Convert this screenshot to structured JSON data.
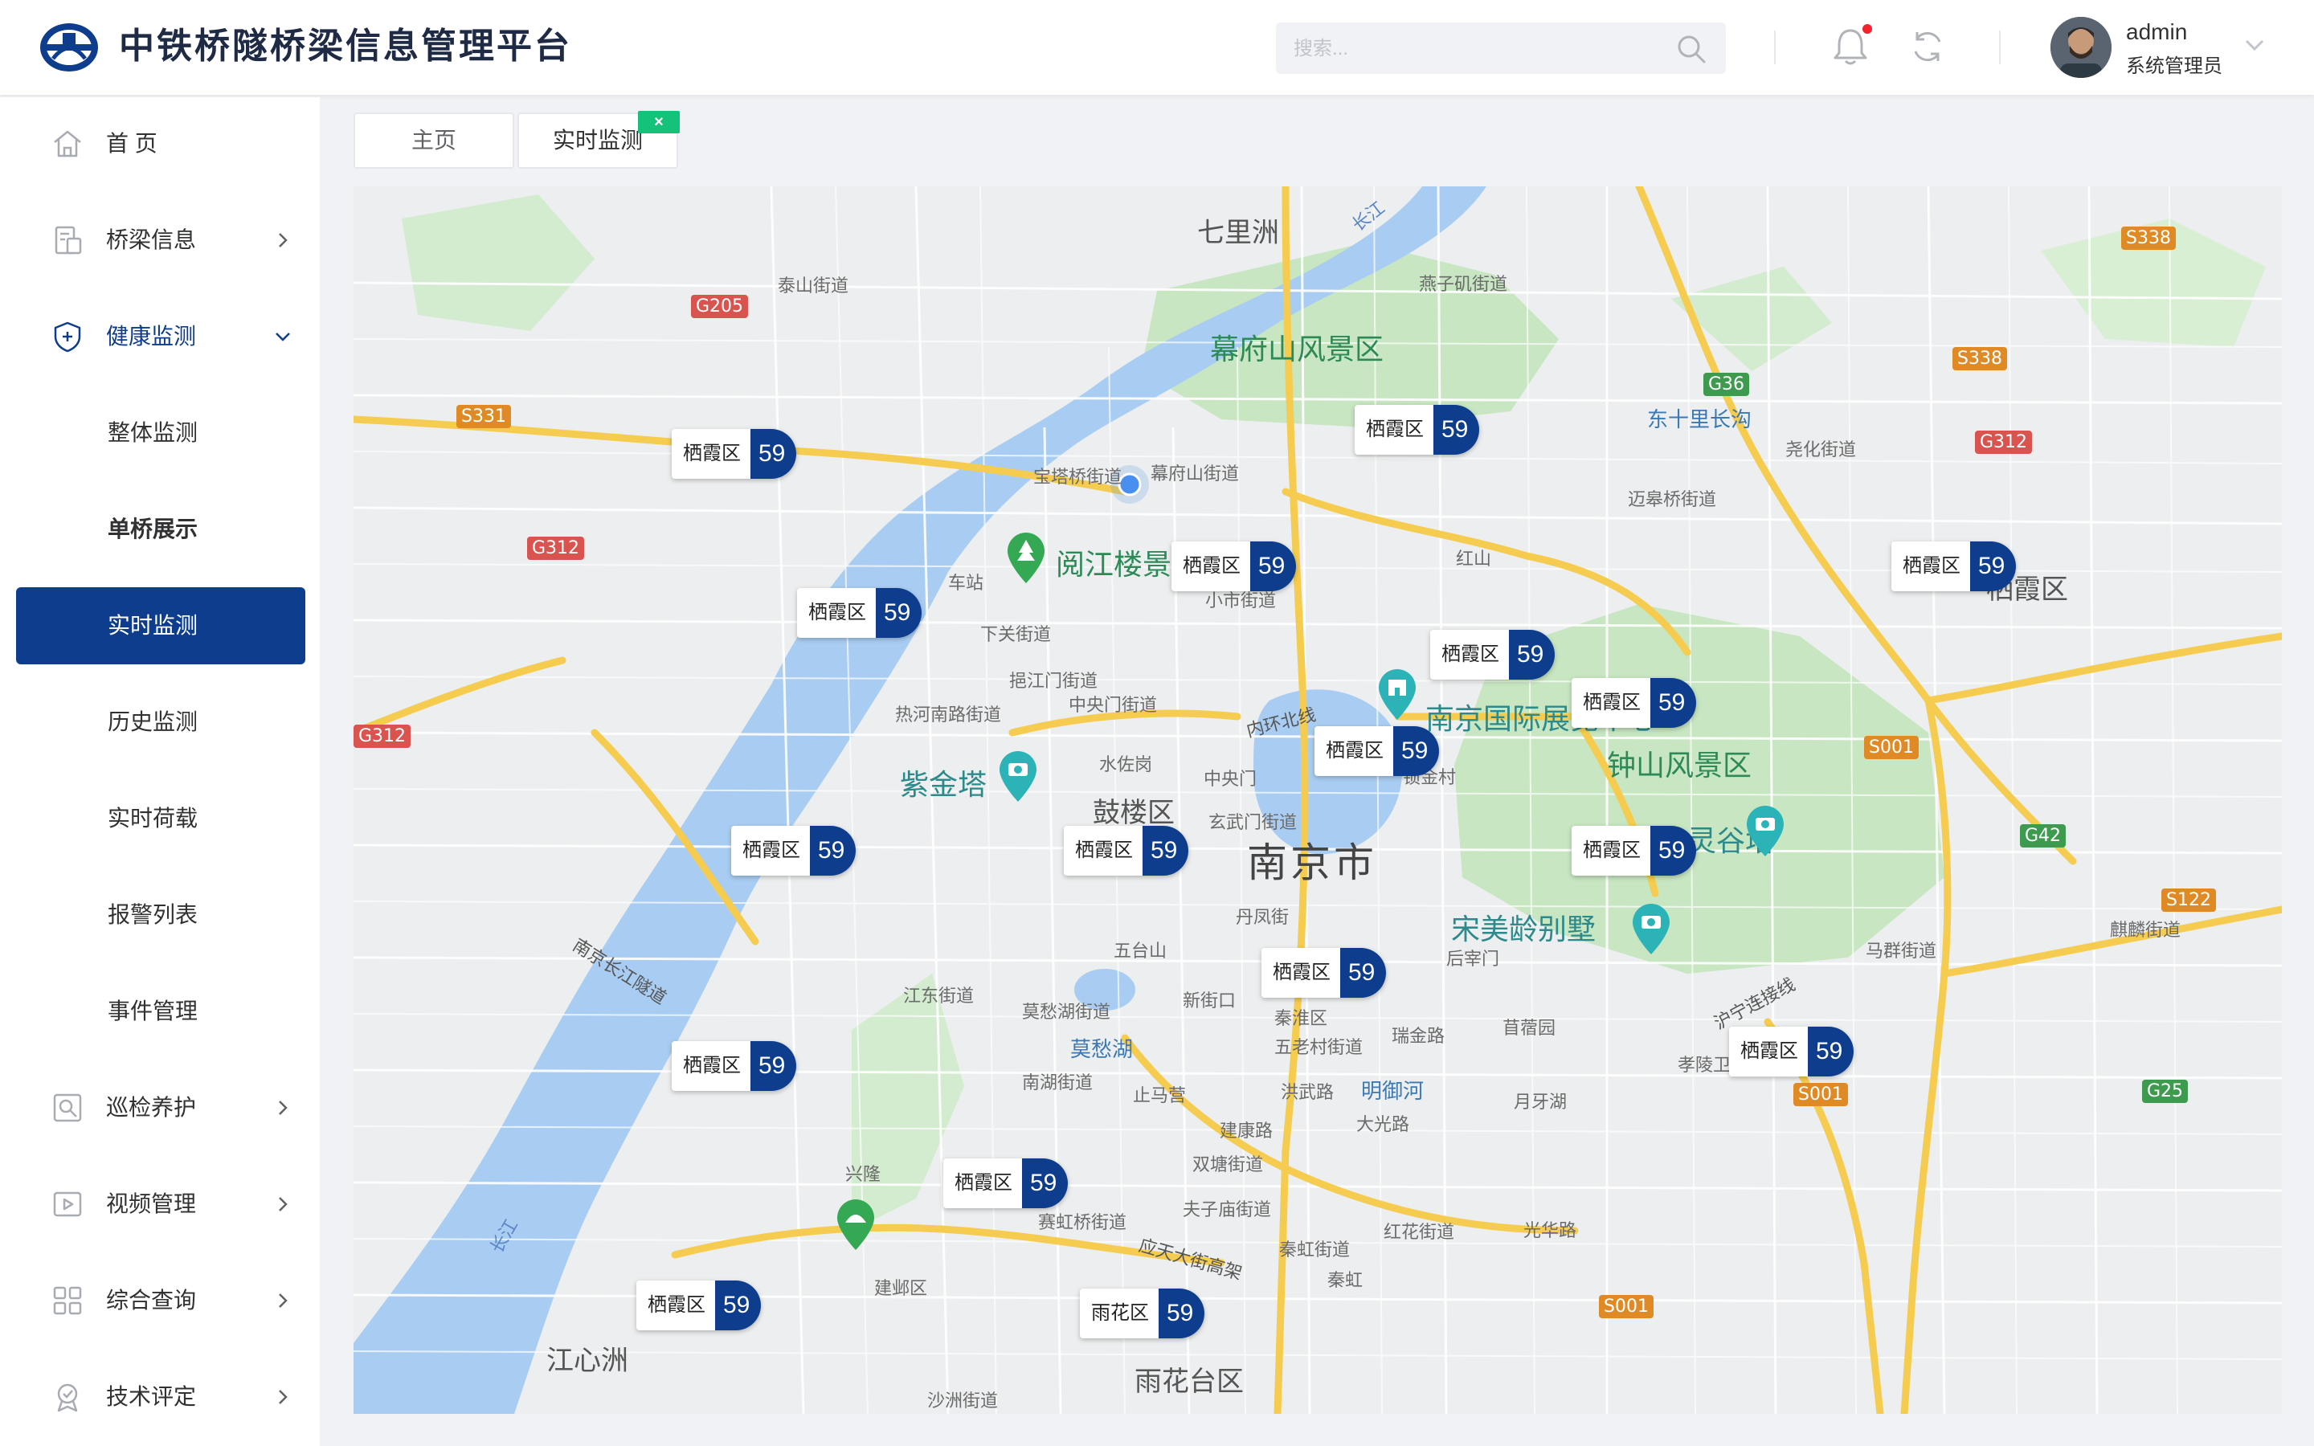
{
  "header": {
    "title": "中铁桥隧桥梁信息管理平台",
    "search_placeholder": "搜索...",
    "user": {
      "name": "admin",
      "role": "系统管理员"
    },
    "notification_dot": true
  },
  "sidebar": {
    "items": [
      {
        "label": "首 页",
        "icon": "home-icon"
      },
      {
        "label": "桥梁信息",
        "icon": "building-icon",
        "has_arrow": true
      },
      {
        "label": "健康监测",
        "icon": "shield-icon",
        "expanded": true,
        "children": [
          {
            "label": "整体监测"
          },
          {
            "label": "单桥展示"
          },
          {
            "label": "实时监测",
            "active": true
          },
          {
            "label": "历史监测"
          },
          {
            "label": "实时荷载"
          },
          {
            "label": "报警列表"
          },
          {
            "label": "事件管理"
          }
        ]
      },
      {
        "label": "巡检养护",
        "icon": "inspection-icon",
        "has_arrow": true
      },
      {
        "label": "视频管理",
        "icon": "video-icon",
        "has_arrow": true
      },
      {
        "label": "综合查询",
        "icon": "grid-icon",
        "has_arrow": true
      },
      {
        "label": "技术评定",
        "icon": "badge-icon",
        "has_arrow": true
      }
    ]
  },
  "tabs": [
    {
      "label": "主页"
    },
    {
      "label": "实时监测",
      "active": true,
      "close": "×"
    }
  ],
  "map": {
    "city_label": "南京市",
    "district_labels": [
      "鼓楼区",
      "栖霞区",
      "雨花台区",
      "秦淮区",
      "建邺区"
    ],
    "scenic_labels": [
      "幕府山风景区",
      "钟山风景区",
      "阅江楼景",
      "紫金塔",
      "宋美龄别墅",
      "灵谷塔",
      "南京国际展览中心"
    ],
    "places": [
      "七里洲",
      "江心洲",
      "泰山街道",
      "燕子矶街道",
      "宝塔桥街道",
      "幕府山街道",
      "迈皋桥街道",
      "尧化街道",
      "东十里长沟",
      "车站",
      "下关街道",
      "挹江门街道",
      "中央门街道",
      "小市街道",
      "红山",
      "热河南路街道",
      "水佐岗",
      "中央门",
      "玄武门街道",
      "锁金村",
      "五台山",
      "丹凤街",
      "江东街道",
      "莫愁湖街道",
      "莫愁湖",
      "南湖街道",
      "止马营",
      "新街口",
      "秦淮区",
      "五老村街道",
      "瑞金路",
      "后宰门",
      "苜蓿园",
      "孝陵卫",
      "月牙湖",
      "洪武路",
      "明御河",
      "大光路",
      "建康路",
      "双塘街道",
      "夫子庙街道",
      "兴隆",
      "赛虹桥街道",
      "秦虹街道",
      "秦虹",
      "红花街道",
      "光华路",
      "建邺区",
      "沙洲街道",
      "马群街道",
      "麒麟街道",
      "南京长江隧道",
      "内环北线",
      "应天大街高架",
      "沪宁连接线",
      "长江"
    ],
    "road_shields": [
      "G205",
      "S331",
      "G312",
      "G36",
      "S338",
      "S001",
      "G42",
      "S122",
      "G25"
    ],
    "markers": [
      {
        "name": "栖霞区",
        "value": "59"
      },
      {
        "name": "栖霞区",
        "value": "59"
      },
      {
        "name": "栖霞区",
        "value": "59"
      },
      {
        "name": "栖霞区",
        "value": "59"
      },
      {
        "name": "栖霞区",
        "value": "59"
      },
      {
        "name": "栖霞区",
        "value": "59"
      },
      {
        "name": "栖霞区",
        "value": "59"
      },
      {
        "name": "栖霞区",
        "value": "59"
      },
      {
        "name": "栖霞区",
        "value": "59"
      },
      {
        "name": "栖霞区",
        "value": "59"
      },
      {
        "name": "栖霞区",
        "value": "59"
      },
      {
        "name": "栖霞区",
        "value": "59"
      },
      {
        "name": "栖霞区",
        "value": "59"
      },
      {
        "name": "栖霞区",
        "value": "59"
      },
      {
        "name": "栖霞区",
        "value": "59"
      },
      {
        "name": "栖霞区",
        "value": "59"
      },
      {
        "name": "雨花区",
        "value": "59"
      }
    ]
  },
  "colors": {
    "primary": "#0d3d8c",
    "success": "#15c27a",
    "alert": "#f5222d",
    "water": "#a9cdf2",
    "green_area": "#c7e6c1"
  }
}
